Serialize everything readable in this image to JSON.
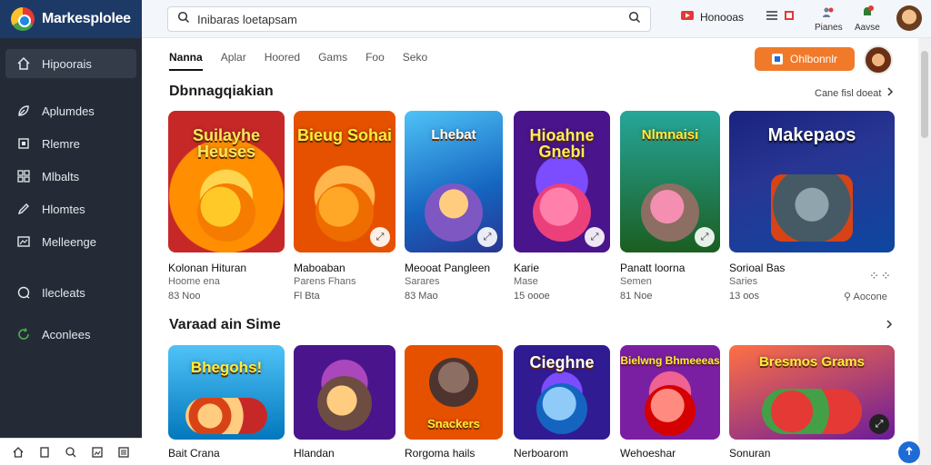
{
  "brand": {
    "name": "Markesplolee"
  },
  "sidebar": {
    "items": [
      {
        "label": "Hipoorais",
        "icon": "home-icon"
      },
      {
        "label": "Aplumdes",
        "icon": "leaf-icon"
      },
      {
        "label": "Rlemre",
        "icon": "square-icon"
      },
      {
        "label": "Mlbalts",
        "icon": "grid-icon"
      },
      {
        "label": "Hlomtes",
        "icon": "pencil-icon"
      },
      {
        "label": "Melleenge",
        "icon": "image-icon"
      },
      {
        "label": "Ilecleats",
        "icon": "chat-icon"
      },
      {
        "label": "Aconlees",
        "icon": "refresh-icon"
      }
    ]
  },
  "topbar": {
    "search_value": "Inibaras loetapsam",
    "notif_label": "Honooas",
    "notif2_label": "Pianes",
    "notif3_label": "Aavse"
  },
  "tabs": [
    "Nanna",
    "Aplar",
    "Hoored",
    "Gams",
    "Foo",
    "Seko"
  ],
  "cta_label": "Ohlbonnlr",
  "sections": [
    {
      "title": "Dbnnagqiakian",
      "see_all": "Cane fisl doeat",
      "cards": [
        {
          "art": "Suilayhe Heuses",
          "name": "Kolonan Hituran",
          "sub": "Hoome ena",
          "meta": "83 Noo"
        },
        {
          "art": "Bieug Sohai",
          "name": "Maboaban",
          "sub": "Parens Fhans",
          "meta": "Fl Bta"
        },
        {
          "art": "Lhebat",
          "name": "Meooat Pangleen",
          "sub": "Sarares",
          "meta": "83 Mao"
        },
        {
          "art": "Hioahne Gnebi",
          "name": "Karie",
          "sub": "Mase",
          "meta": "15 oooe"
        },
        {
          "art": "Nlmnaisi",
          "name": "Panatt loorna",
          "sub": "Semen",
          "meta": "81 Noe"
        },
        {
          "art": "Makepaos",
          "name": "Sorioal Bas",
          "sub": "Saries",
          "meta": "13 oos"
        }
      ],
      "extra_meta": "Aocone"
    },
    {
      "title": "Varaad ain Sime",
      "cards": [
        {
          "art": "Bhegohs!",
          "name": "Bait Crana"
        },
        {
          "art": "",
          "name": "Hlandan"
        },
        {
          "art": "Snackers",
          "name": "Rorgoma hails"
        },
        {
          "art": "Cieghne",
          "name": "Nerboarom"
        },
        {
          "art": "Bielwng Bhmeeeas",
          "name": "Wehoeshar"
        },
        {
          "art": "Bresmos Grams",
          "name": "Sonuran"
        }
      ]
    }
  ],
  "colors": {
    "accent": "#f07a2a",
    "sidebar_bg": "#252b36",
    "brand_bg": "#1d3a66",
    "fab": "#1e6bd6"
  }
}
